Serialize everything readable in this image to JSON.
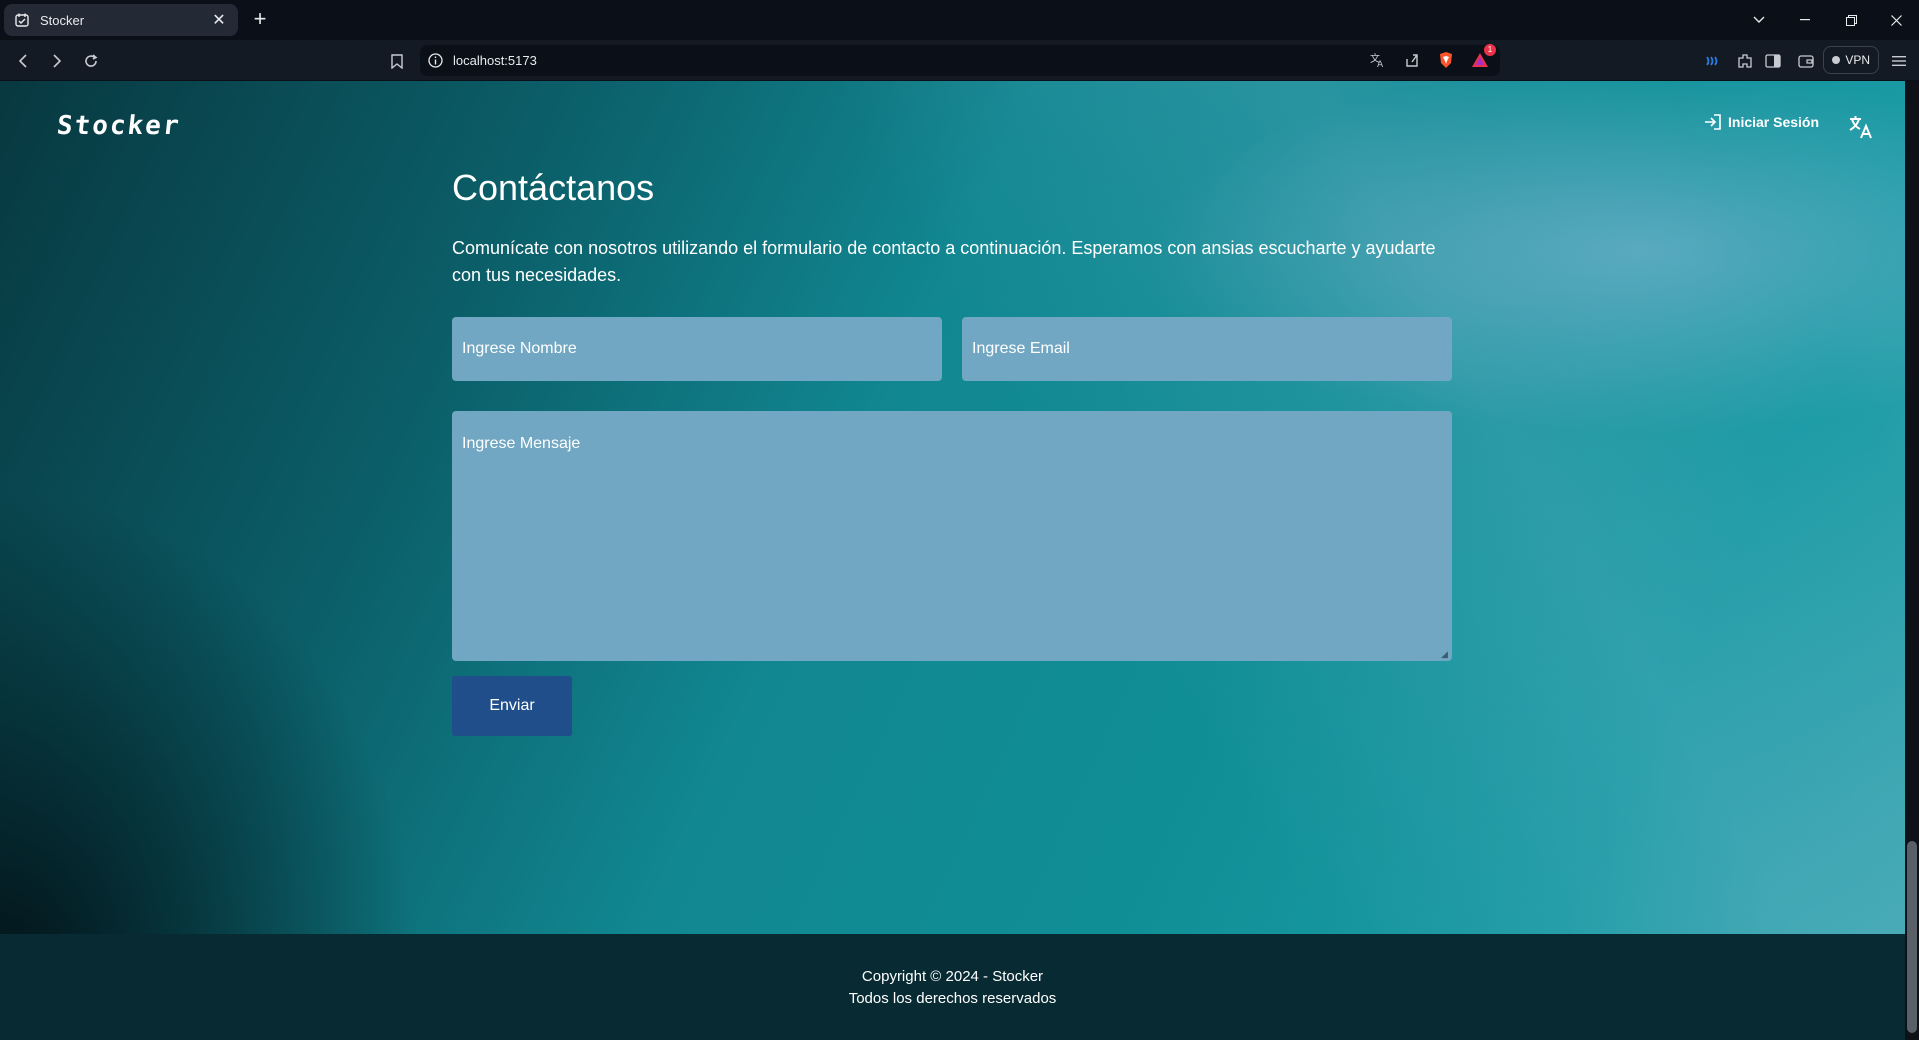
{
  "browser": {
    "tab_title": "Stocker",
    "url": "localhost:5173",
    "vpn_label": "VPN",
    "brave_badge_count": "1"
  },
  "header": {
    "logo": "Stocker",
    "login_label": "Iniciar Sesión"
  },
  "contact": {
    "title": "Contáctanos",
    "description": "Comunícate con nosotros utilizando el formulario de contacto a continuación. Esperamos con ansias escucharte y ayudarte con tus necesidades.",
    "name_placeholder": "Ingrese Nombre",
    "email_placeholder": "Ingrese Email",
    "message_placeholder": "Ingrese Mensaje",
    "submit_label": "Enviar"
  },
  "footer": {
    "copyright": "Copyright © 2024 - Stocker",
    "rights": "Todos los derechos reservados"
  },
  "colors": {
    "input_bg": "#71a7c2",
    "button_bg": "#1f4e8a",
    "footer_bg": "#072a33",
    "hero_teal": "#108e96"
  }
}
